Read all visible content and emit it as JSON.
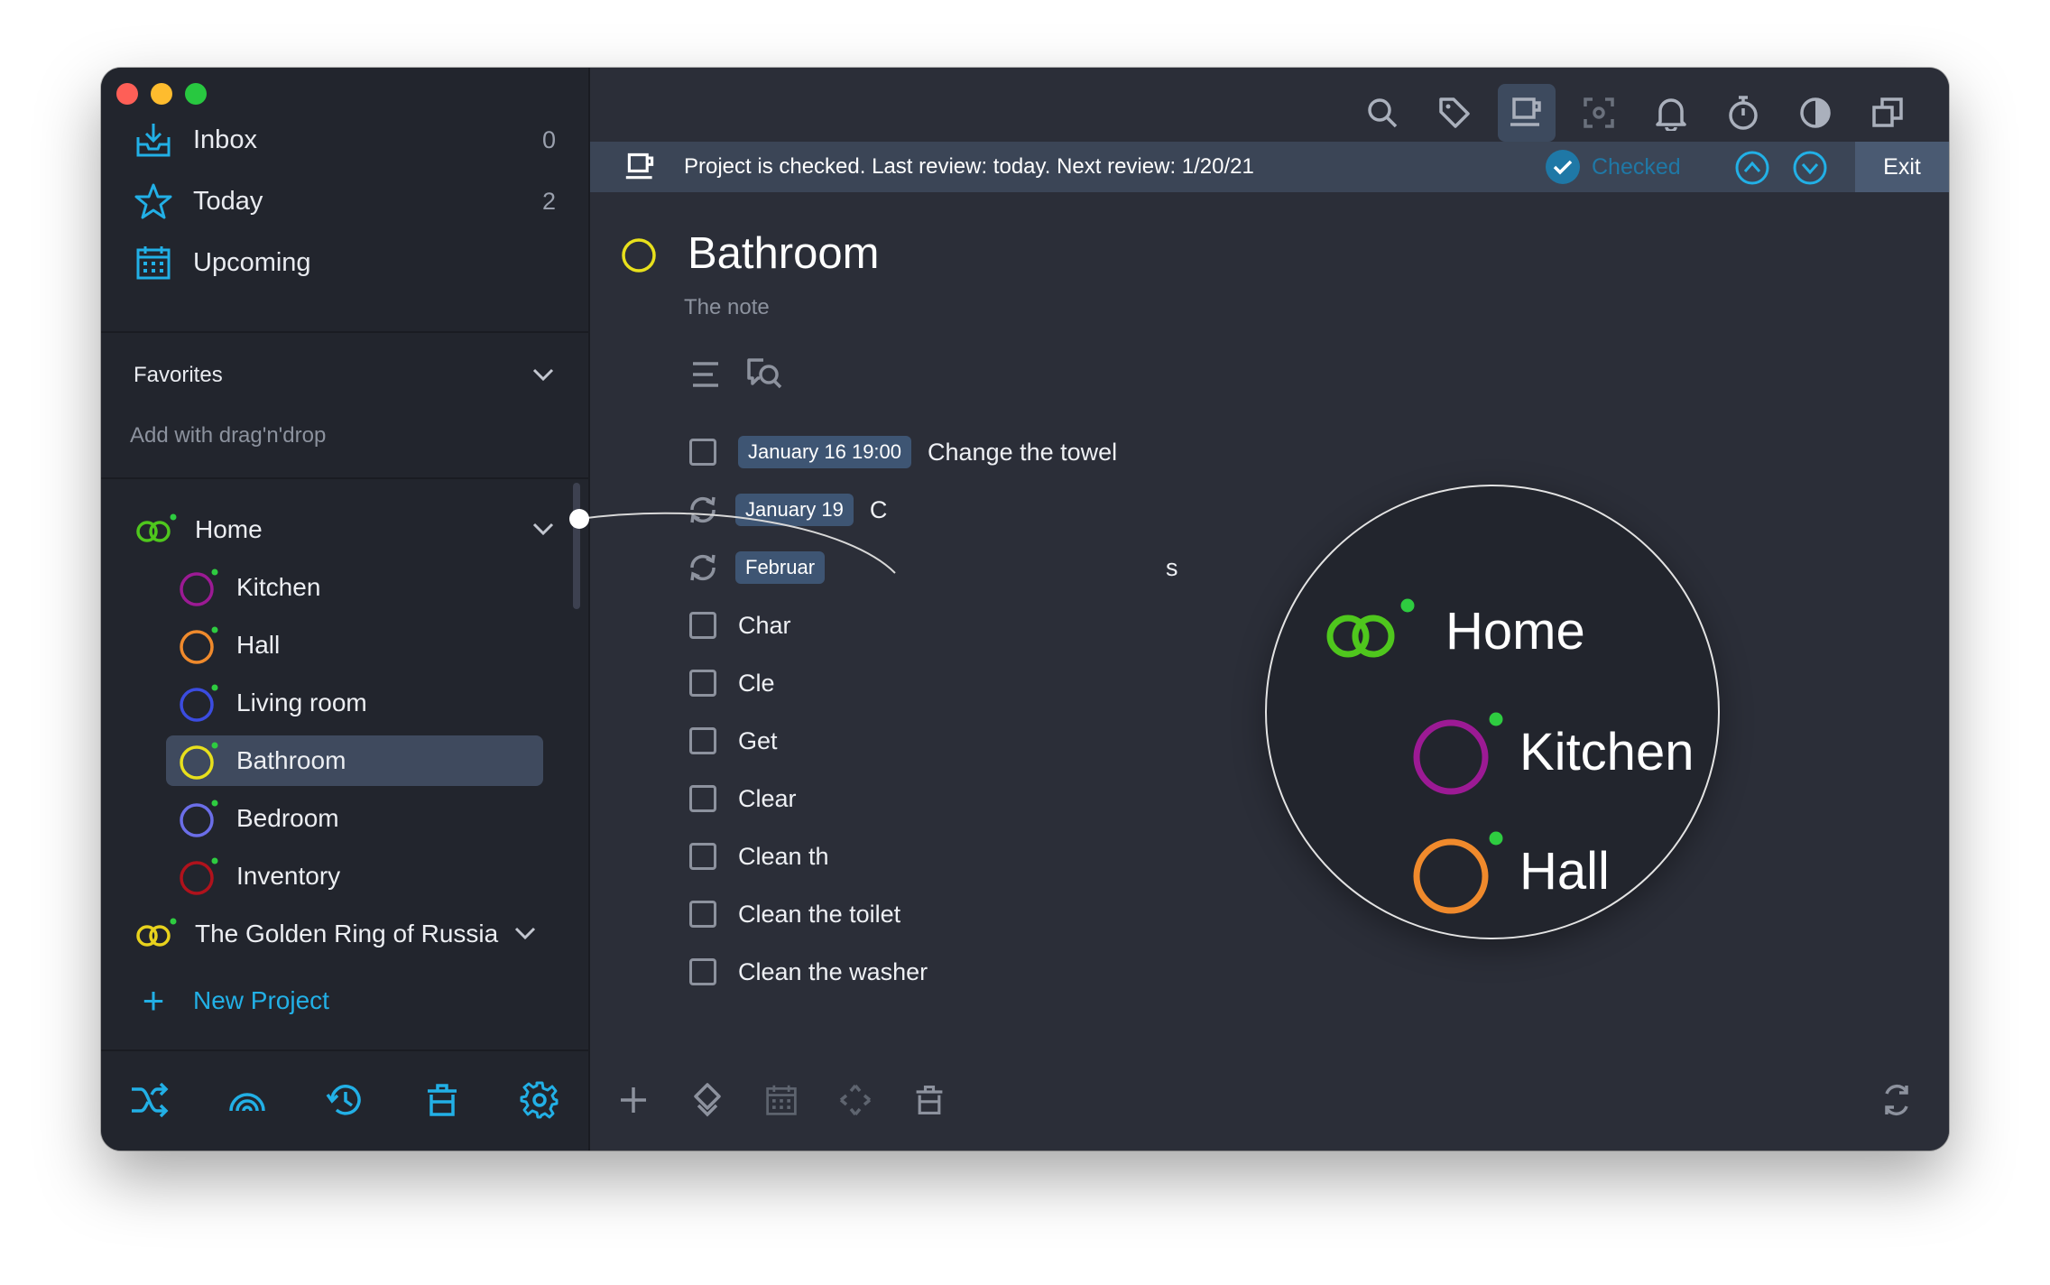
{
  "sidebar": {
    "nav": [
      {
        "label": "Inbox",
        "count": "0",
        "icon": "inbox-tray-icon"
      },
      {
        "label": "Today",
        "count": "2",
        "icon": "star-icon"
      },
      {
        "label": "Upcoming",
        "count": "",
        "icon": "calendar-icon"
      }
    ],
    "favorites": {
      "title": "Favorites",
      "hint": "Add with drag'n'drop"
    },
    "projects": [
      {
        "label": "Home",
        "icon": "area-rings-icon",
        "color": "#4fc71d"
      },
      {
        "label": "The Golden Ring of Russia",
        "icon": "area-rings-icon",
        "color": "#e8d21d"
      }
    ],
    "subprojects": [
      {
        "label": "Kitchen",
        "color": "#9c1a94"
      },
      {
        "label": "Hall",
        "color": "#f08a2c"
      },
      {
        "label": "Living room",
        "color": "#3b4ce0"
      },
      {
        "label": "Bathroom",
        "color": "#e8e01c"
      },
      {
        "label": "Bedroom",
        "color": "#6b6ee8"
      },
      {
        "label": "Inventory",
        "color": "#b0121c"
      }
    ],
    "new_project": "New Project",
    "bottom_icons": [
      "shuffle-icon",
      "rainbow-icon",
      "history-icon",
      "trash-icon",
      "settings-gear-icon"
    ]
  },
  "toolbar": {
    "icons": [
      "search-icon",
      "tag-icon",
      "review-cup-icon",
      "focus-icon",
      "bell-icon",
      "stopwatch-icon",
      "contrast-icon",
      "windows-icon"
    ]
  },
  "review": {
    "message": "Project is checked. Last review: today. Next review: 1/20/21",
    "checked_label": "Checked",
    "exit_label": "Exit"
  },
  "project": {
    "title": "Bathroom",
    "note": "The note",
    "color": "#e8e01c"
  },
  "tasks": [
    {
      "kind": "checkbox",
      "date": "January 16 19:00",
      "title": "Change the towel"
    },
    {
      "kind": "repeat",
      "date": "January 19",
      "title": "C"
    },
    {
      "kind": "repeat",
      "date": "Februar",
      "title": "s"
    },
    {
      "kind": "checkbox",
      "date": "",
      "title": "Char"
    },
    {
      "kind": "checkbox",
      "date": "",
      "title": "Cle"
    },
    {
      "kind": "checkbox",
      "date": "",
      "title": "Get"
    },
    {
      "kind": "checkbox",
      "date": "",
      "title": "Clear"
    },
    {
      "kind": "checkbox",
      "date": "",
      "title": "Clean th"
    },
    {
      "kind": "checkbox",
      "date": "",
      "title": "Clean the toilet"
    },
    {
      "kind": "checkbox",
      "date": "",
      "title": "Clean the washer"
    }
  ],
  "magnifier": {
    "rows": [
      {
        "label": "Home",
        "color": "#4fc71d"
      },
      {
        "label": "Kitchen",
        "color": "#9c1a94"
      },
      {
        "label": "Hall",
        "color": "#f08a2c"
      }
    ]
  },
  "colors": {
    "accent": "#22b0e6",
    "status_dot": "#2ecc40"
  }
}
